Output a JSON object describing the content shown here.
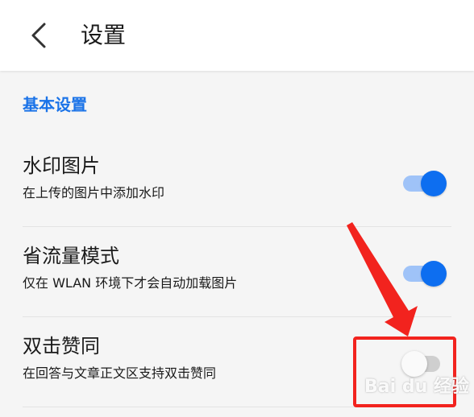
{
  "header": {
    "title": "设置",
    "back_icon": "chevron-left-icon"
  },
  "section": {
    "title": "基本设置",
    "color": "#1a73e8"
  },
  "settings": [
    {
      "label": "水印图片",
      "description": "在上传的图片中添加水印",
      "enabled": true
    },
    {
      "label": "省流量模式",
      "description": "仅在 WLAN 环境下才会自动加载图片",
      "enabled": true
    },
    {
      "label": "双击赞同",
      "description": "在回答与文章正文区支持双击赞同",
      "enabled": false
    }
  ],
  "annotation": {
    "color": "#f2231e"
  },
  "watermark": {
    "text": "Bai du 经验",
    "icon": "baidu-paw-icon"
  }
}
